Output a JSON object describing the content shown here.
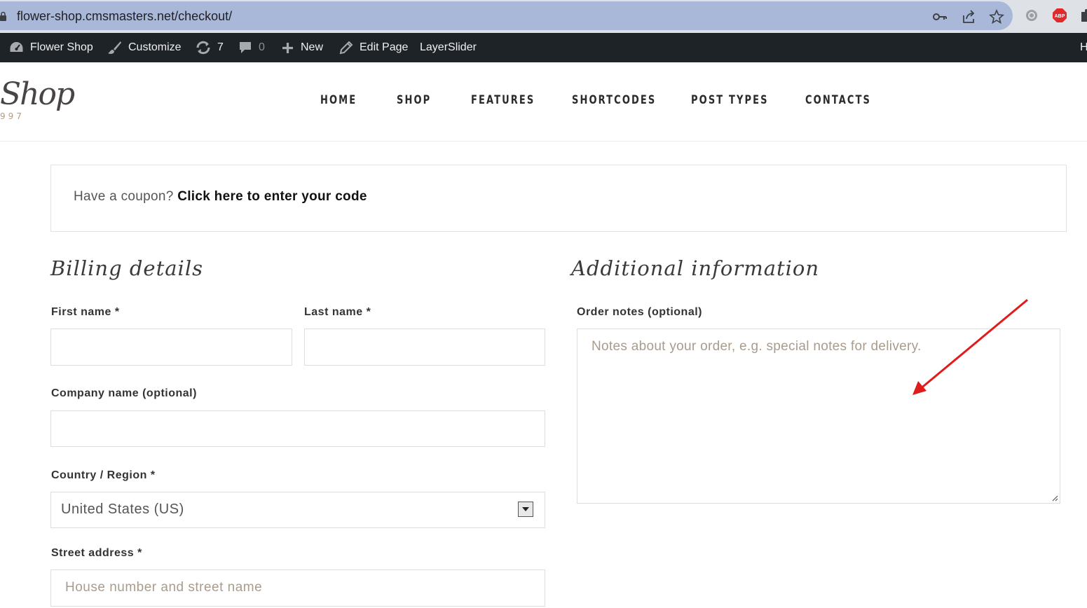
{
  "browser": {
    "url": "flower-shop.cmsmasters.net/checkout/",
    "extension_abp": "ABP"
  },
  "admin_bar": {
    "site_name": "Flower Shop",
    "customize": "Customize",
    "updates_count": "7",
    "comments_count": "0",
    "new": "New",
    "edit_page": "Edit Page",
    "layerslider": "LayerSlider",
    "right_edge": "H"
  },
  "header": {
    "logo_script": "Shop",
    "logo_year": "997",
    "nav": [
      "HOME",
      "SHOP",
      "FEATURES",
      "SHORTCODES",
      "POST TYPES",
      "CONTACTS"
    ]
  },
  "coupon": {
    "prompt": "Have a coupon?",
    "link": "Click here to enter your code"
  },
  "billing": {
    "title": "Billing details",
    "first_name_label": "First name *",
    "last_name_label": "Last name *",
    "company_label": "Company name (optional)",
    "country_label": "Country / Region *",
    "country_value": "United States (US)",
    "street_label": "Street address *",
    "street_placeholder": "House number and street name"
  },
  "additional": {
    "title": "Additional information",
    "order_notes_label": "Order notes (optional)",
    "order_notes_placeholder": "Notes about your order, e.g. special notes for delivery."
  },
  "colors": {
    "admin_bar": "#1d2327",
    "omnibox": "#a9b8d8",
    "annotation": "#e01b1b"
  }
}
